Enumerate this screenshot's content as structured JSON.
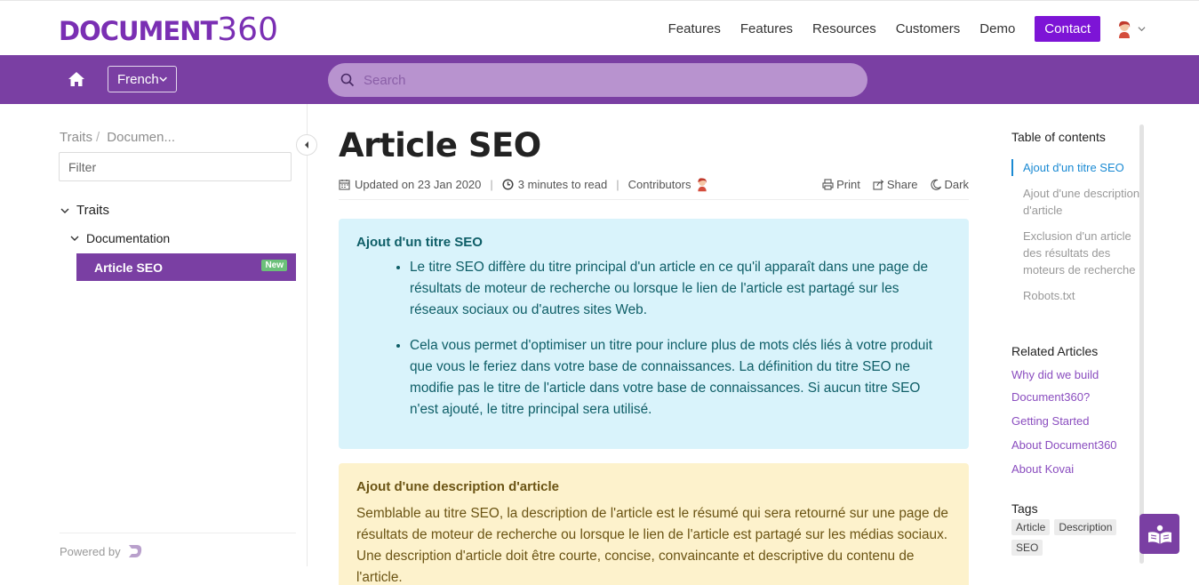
{
  "header": {
    "logo_text": "DOCUMENT",
    "logo_number": "360",
    "nav": [
      "Features",
      "Features",
      "Resources",
      "Customers",
      "Demo"
    ],
    "contact_label": "Contact"
  },
  "subbar": {
    "language": "French",
    "search_placeholder": "Search"
  },
  "sidebar": {
    "breadcrumb": [
      "Traits",
      "Documen..."
    ],
    "filter_placeholder": "Filter",
    "tree": {
      "root": "Traits",
      "child": "Documentation",
      "active": "Article SEO",
      "active_badge": "New"
    },
    "powered_by": "Powered by"
  },
  "article": {
    "title": "Article SEO",
    "updated": "Updated on 23 Jan 2020",
    "read_time": "3 minutes to read",
    "contributors": "Contributors",
    "actions": {
      "print": "Print",
      "share": "Share",
      "dark": "Dark"
    },
    "section1": {
      "heading": "Ajout d'un titre SEO",
      "bullets": [
        "Le titre SEO diffère du titre principal d'un article en ce qu'il apparaît dans une page de résultats de moteur de recherche ou lorsque le lien de l'article est partagé sur les réseaux sociaux ou d'autres sites Web.",
        "Cela vous permet d'optimiser un titre pour inclure plus de mots clés liés à votre produit que vous le feriez dans votre base de connaissances. La définition du titre SEO ne modifie pas le titre de l'article dans votre base de connaissances. Si aucun titre SEO n'est ajouté, le titre principal sera utilisé."
      ]
    },
    "section2": {
      "heading": "Ajout d'une description d'article",
      "body": "Semblable au titre SEO, la description de l'article est le résumé qui sera retourné sur une page de résultats de moteur de recherche ou lorsque le lien de l'article est partagé sur les médias sociaux. Une description d'article doit être courte, concise, convaincante et descriptive du contenu de l'article."
    }
  },
  "toc": {
    "heading": "Table of contents",
    "items": [
      "Ajout d'un titre SEO",
      "Ajout d'une description d'article",
      "Exclusion d'un article des résultats des moteurs de recherche",
      "Robots.txt"
    ]
  },
  "related": {
    "heading": "Related Articles",
    "items": [
      "Why did we build Document360?",
      "Getting Started",
      "About Document360",
      "About Kovai"
    ]
  },
  "tags": {
    "heading": "Tags",
    "items": [
      "Article",
      "Description",
      "SEO"
    ]
  },
  "colors": {
    "brand_purple": "#7a3fa3",
    "contact_purple": "#7d14d6",
    "info_blue_bg": "#d9f3fb",
    "note_yellow_bg": "#fdf2cc",
    "toc_active": "#1a8ad3"
  },
  "icons": {
    "home": "home-icon",
    "search": "search-icon",
    "calendar": "calendar-icon",
    "clock": "clock-icon",
    "print": "print-icon",
    "share": "share-icon",
    "dark": "moon-icon",
    "fab": "book-reader-icon"
  }
}
